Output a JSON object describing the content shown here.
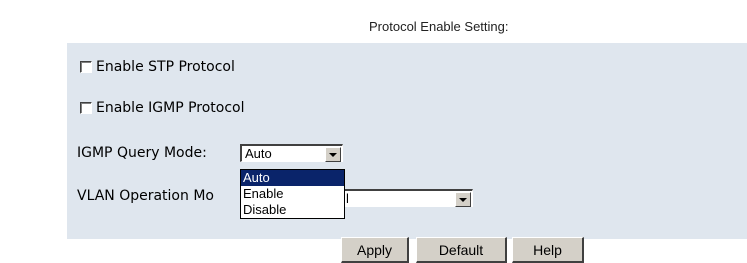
{
  "page_title": "Protocol Enable Setting:",
  "checkboxes": [
    {
      "label": "Enable STP Protocol",
      "checked": false
    },
    {
      "label": "Enable IGMP Protocol",
      "checked": false
    }
  ],
  "igmp_query_mode": {
    "label": "IGMP Query Mode:",
    "value": "Auto",
    "options": [
      "Auto",
      "Enable",
      "Disable"
    ],
    "highlighted": "Auto"
  },
  "vlan_operation_mode": {
    "label_visible": "VLAN Operation Mo",
    "value_visible": "l"
  },
  "buttons": {
    "apply": "Apply",
    "default": "Default",
    "help": "Help"
  },
  "colors": {
    "panel_bg": "#dfe6ee",
    "selection_bg": "#0a246a",
    "button_face": "#d4d0c8"
  }
}
